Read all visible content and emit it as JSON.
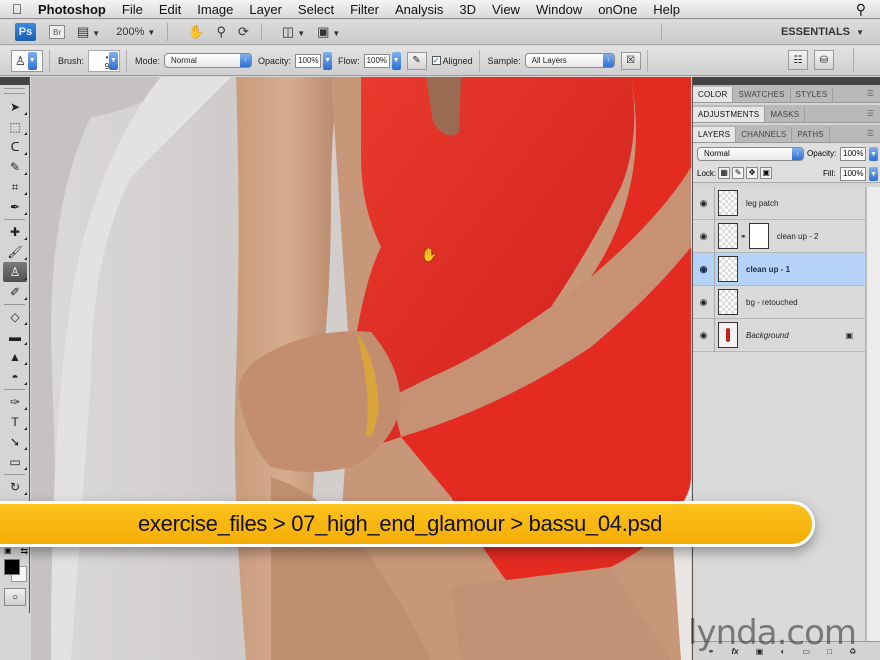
{
  "menubar": {
    "app_name": "Photoshop",
    "items": [
      "File",
      "Edit",
      "Image",
      "Layer",
      "Select",
      "Filter",
      "Analysis",
      "3D",
      "View",
      "Window",
      "onOne",
      "Help"
    ]
  },
  "appbar": {
    "ps_label": "Ps",
    "br_label": "Br",
    "zoom": "200%",
    "workspace": "ESSENTIALS"
  },
  "options": {
    "brush_label": "Brush:",
    "brush_size": "9",
    "mode_label": "Mode:",
    "mode_value": "Normal",
    "opacity_label": "Opacity:",
    "opacity_value": "100%",
    "flow_label": "Flow:",
    "flow_value": "100%",
    "aligned_label": "Aligned",
    "aligned_checked": true,
    "sample_label": "Sample:",
    "sample_value": "All Layers"
  },
  "tools": [
    {
      "name": "move-tool",
      "glyph": "➤"
    },
    {
      "name": "marquee-tool",
      "glyph": "⬚"
    },
    {
      "name": "lasso-tool",
      "glyph": "ᑕ"
    },
    {
      "name": "quick-selection-tool",
      "glyph": "✎"
    },
    {
      "name": "crop-tool",
      "glyph": "⌗"
    },
    {
      "name": "eyedropper-tool",
      "glyph": "✒"
    },
    {
      "name": "spot-healing-tool",
      "glyph": "✚"
    },
    {
      "name": "brush-tool",
      "glyph": "🖌"
    },
    {
      "name": "clone-stamp-tool",
      "glyph": "♙",
      "active": true
    },
    {
      "name": "history-brush-tool",
      "glyph": "✐"
    },
    {
      "name": "eraser-tool",
      "glyph": "◇"
    },
    {
      "name": "gradient-tool",
      "glyph": "▬"
    },
    {
      "name": "blur-tool",
      "glyph": "▲"
    },
    {
      "name": "dodge-tool",
      "glyph": "◓"
    },
    {
      "name": "pen-tool",
      "glyph": "✑"
    },
    {
      "name": "type-tool",
      "glyph": "T"
    },
    {
      "name": "path-selection-tool",
      "glyph": "➘"
    },
    {
      "name": "shape-tool",
      "glyph": "▭"
    },
    {
      "name": "3d-rotate-tool",
      "glyph": "↻"
    },
    {
      "name": "3d-orbit-tool",
      "glyph": "↺"
    }
  ],
  "colors": {
    "foreground": "#000000",
    "background": "#f6f6f6",
    "selection": "#b5d3f6",
    "banner": "#f9b90f"
  },
  "panels": {
    "group1_tabs": [
      "COLOR",
      "SWATCHES",
      "STYLES"
    ],
    "group2_tabs": [
      "ADJUSTMENTS",
      "MASKS"
    ],
    "group3_tabs": [
      "LAYERS",
      "CHANNELS",
      "PATHS"
    ],
    "blend_mode": "Normal",
    "opacity_label": "Opacity:",
    "opacity_value": "100%",
    "lock_label": "Lock:",
    "fill_label": "Fill:",
    "fill_value": "100%",
    "layers": [
      {
        "name": "leg patch",
        "visible": true,
        "selected": false
      },
      {
        "name": "clean up - 2",
        "visible": true,
        "selected": false,
        "has_mask": true
      },
      {
        "name": "clean up - 1",
        "visible": true,
        "selected": true
      },
      {
        "name": "bg - retouched",
        "visible": true,
        "selected": false
      },
      {
        "name": "Background",
        "visible": true,
        "selected": false,
        "locked": true
      }
    ],
    "footer_icons": [
      "link-layers",
      "fx",
      "add-mask",
      "adjustment-layer",
      "new-group",
      "new-layer",
      "delete-layer"
    ]
  },
  "banner": {
    "path": "exercise_files > 07_high_end_glamour > bassu_04.psd"
  },
  "watermark": "lynda.com"
}
